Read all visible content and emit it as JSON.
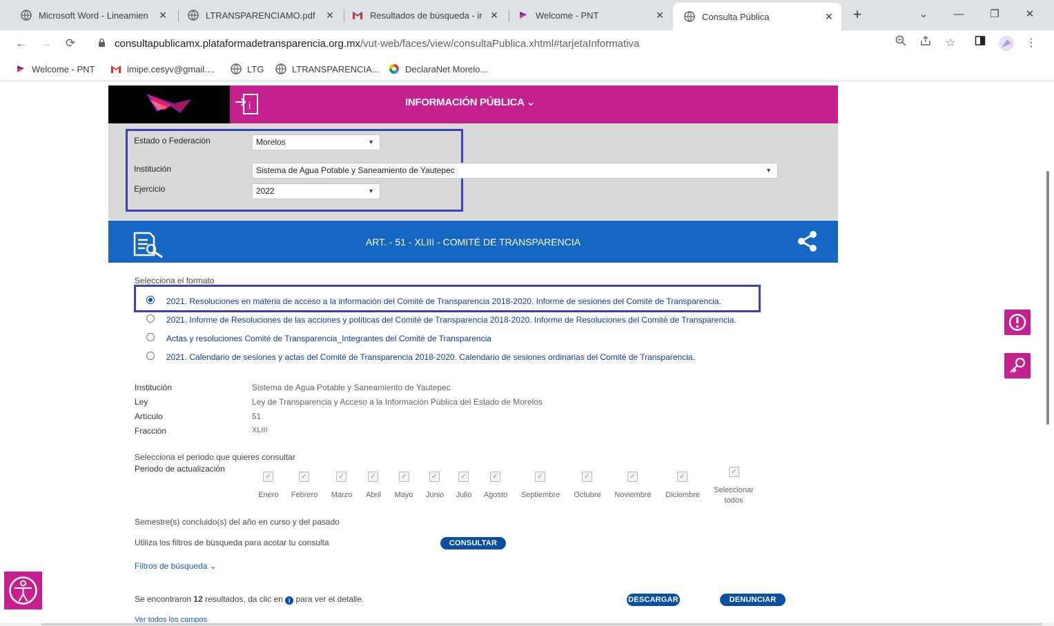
{
  "browser": {
    "tabs": [
      {
        "title": "Microsoft Word - Lineamien",
        "icon": "globe-icon"
      },
      {
        "title": "LTRANSPARENCIAMO.pdf",
        "icon": "globe-icon"
      },
      {
        "title": "Resultados de búsqueda - ir",
        "icon": "gmail-icon"
      },
      {
        "title": "Welcome - PNT",
        "icon": "pnt-icon"
      },
      {
        "title": "Consulta Pública",
        "icon": "globe-icon"
      }
    ],
    "url_host": "consultapublicamx.plataformadetransparencia.org.mx",
    "url_path": "/vut-web/faces/view/consultaPublica.xhtml#tarjetaInformativa",
    "bookmarks": [
      {
        "label": "Welcome - PNT",
        "icon": "pnt-icon"
      },
      {
        "label": "imipe.cesyv@gmail....",
        "icon": "gmail-icon"
      },
      {
        "label": "LTG",
        "icon": "globe-icon"
      },
      {
        "label": "LTRANSPARENCIA...",
        "icon": "globe-icon"
      },
      {
        "label": "DeclaraNet Morelo...",
        "icon": "declaranet-icon"
      }
    ]
  },
  "header": {
    "menu_label": "INFORMACIÓN PÚBLICA ⌄"
  },
  "filters": {
    "estado_label": "Estado o Federación",
    "estado_value": "Morelos",
    "institucion_label": "Institución",
    "institucion_value": "Sistema de Agua Potable y Saneamiento de Yautepec",
    "ejercicio_label": "Ejercicio",
    "ejercicio_value": "2022"
  },
  "article": {
    "title": "ART. - 51 - XLIII - COMITÉ DE TRANSPARENCIA"
  },
  "formats": {
    "label": "Selecciona el formato",
    "options": [
      "2021. Resoluciones en materia de acceso a la información del Comité de Transparencia 2018-2020. Informe de sesiones del Comité de Transparencia.",
      "2021. Informe de Resoluciones de las acciones y políticas del Comité de Transparencia 2018-2020. Informe de Resoluciones del Comité de Transparencia.",
      "Actas y resoluciones Comité de Transparencia_Integrantes del Comité de Transparencia",
      "2021. Calendario de sesiones y actas del Comité de Transparencia 2018-2020. Calendario de sesiones ordinarias del Comité de Transparencia."
    ],
    "selected_index": 0
  },
  "info": {
    "institucion_label": "Institución",
    "institucion_value": "Sistema de Agua Potable y Saneamiento de Yautepec",
    "ley_label": "Ley",
    "ley_value": "Ley de Transparencia y Acceso a la Información Pública del Estado de Morelos",
    "articulo_label": "Artículo",
    "articulo_value": "51",
    "fraccion_label": "Fracción",
    "fraccion_value": "XLIII"
  },
  "period": {
    "label": "Selecciona el periodo que quieres consultar",
    "sublabel": "Periodo de actualización",
    "months": [
      "Enero",
      "Febrero",
      "Marzo",
      "Abril",
      "Mayo",
      "Junio",
      "Julio",
      "Agosto",
      "Septiembre",
      "Octubre",
      "Noviembre",
      "Diciembre"
    ],
    "select_all_line1": "Seleccionar",
    "select_all_line2": "todos",
    "semester_note": "Semestre(s) concluido(s) del año en curso y del pasado"
  },
  "search": {
    "hint": "Utiliza los filtros de búsqueda para acotar tu consulta",
    "consultar_label": "CONSULTAR",
    "filtros_label": "Filtros de búsqueda ⌄"
  },
  "results": {
    "prefix": "Se encontraron ",
    "count": "12",
    "middle": " resultados, da clic en ",
    "suffix": " para ver el detalle.",
    "descargar_label": "DESCARGAR",
    "denunciar_label": "DENUNCIAR",
    "ver_todos_label": "Ver todos los campos"
  },
  "colors": {
    "magenta": "#c4208f",
    "blue_bar": "#1666c4",
    "highlight": "#3c3fb5",
    "pill": "#0b4fa3"
  }
}
